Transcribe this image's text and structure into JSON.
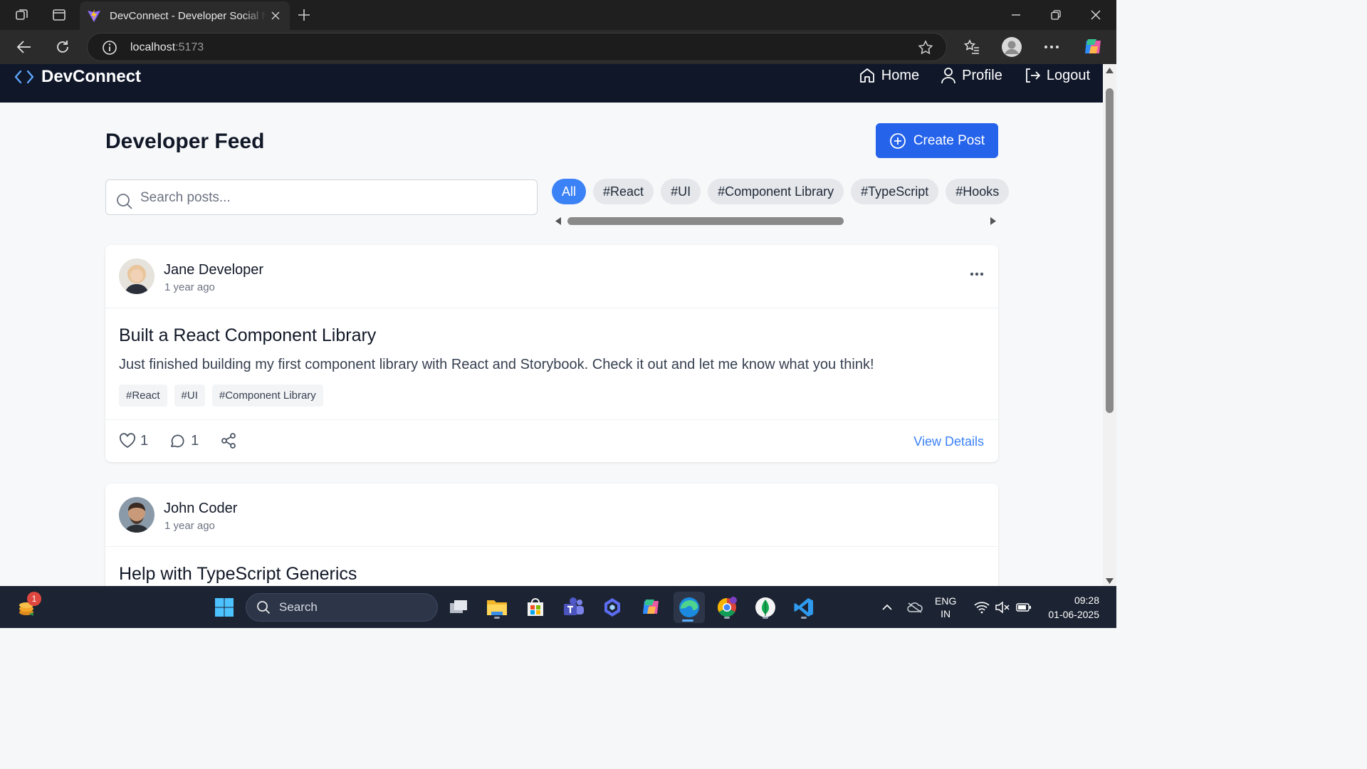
{
  "browser": {
    "tab_title": "DevConnect - Developer Social Network",
    "url_host": "localhost",
    "url_port": ":5173"
  },
  "app": {
    "brand": "DevConnect",
    "nav": {
      "home": "Home",
      "profile": "Profile",
      "logout": "Logout"
    }
  },
  "feed": {
    "title": "Developer Feed",
    "create_button": "Create Post",
    "search_placeholder": "Search posts...",
    "filters": [
      "All",
      "#React",
      "#UI",
      "#Component Library",
      "#TypeScript",
      "#Hooks"
    ],
    "active_filter": "All"
  },
  "posts": [
    {
      "author": "Jane Developer",
      "time": "1 year ago",
      "title": "Built a React Component Library",
      "content": "Just finished building my first component library with React and Storybook. Check it out and let me know what you think!",
      "tags": [
        "#React",
        "#UI",
        "#Component Library"
      ],
      "likes": "1",
      "comments": "1",
      "view_details": "View Details"
    },
    {
      "author": "John Coder",
      "time": "1 year ago",
      "title": "Help with TypeScript Generics"
    }
  ],
  "taskbar": {
    "search_label": "Search",
    "notification_count": "1",
    "lang_line1": "ENG",
    "lang_line2": "IN",
    "time": "09:28",
    "date": "01-06-2025"
  },
  "colors": {
    "navbar": "#0f1729",
    "primary": "#2563eb",
    "active_chip": "#3b82f6",
    "link": "#3b82f6"
  }
}
